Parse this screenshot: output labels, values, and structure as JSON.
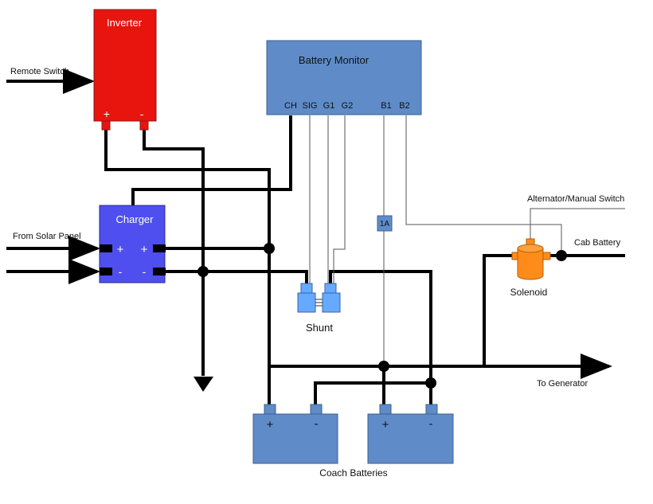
{
  "components": {
    "inverter": {
      "label": "Inverter",
      "plus": "+",
      "minus": "-",
      "color": "#e8140e"
    },
    "battery_monitor": {
      "label": "Battery Monitor",
      "terminals": [
        "CH",
        "SIG",
        "G1",
        "G2",
        "B1",
        "B2"
      ],
      "color": "#5f8cc8"
    },
    "charger": {
      "label": "Charger",
      "plus": "+",
      "minus": "-",
      "color": "#4f4ff0"
    },
    "shunt": {
      "label": "Shunt",
      "color": "#66aaff"
    },
    "fuse": {
      "label": "1A"
    },
    "solenoid": {
      "label": "Solenoid",
      "color": "#ff8c1a"
    },
    "batteries": {
      "label": "Coach Batteries",
      "plus": "+",
      "minus": "-"
    }
  },
  "labels": {
    "remote_switch": "Remote Switch",
    "from_solar": "From Solar Panel",
    "alternator": "Alternator/Manual Switch",
    "cab_battery": "Cab Battery",
    "to_generator": "To Generator"
  }
}
